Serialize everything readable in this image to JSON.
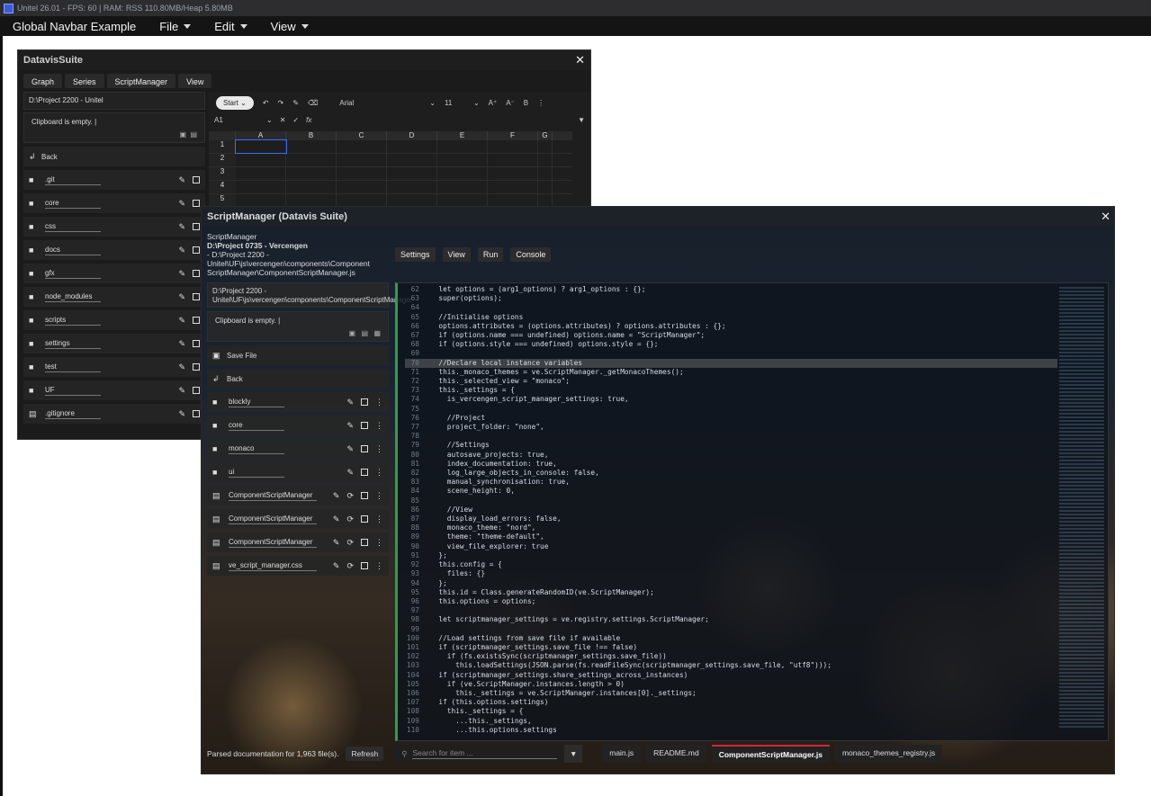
{
  "app_title": "Unitel 26.01 - FPS: 60 | RAM: RSS 110.80MB/Heap 5.80MB",
  "navbar": {
    "brand": "Global Navbar Example",
    "menus": [
      "File",
      "Edit",
      "View"
    ]
  },
  "datavis": {
    "title": "DatavisSuite",
    "tabs": [
      "Graph",
      "Series",
      "ScriptManager",
      "View"
    ],
    "path": "D:\\Project 2200 - Unitel",
    "clipboard": "Clipboard is empty.",
    "back_label": "Back",
    "items": [
      ".git",
      "core",
      "css",
      "docs",
      "gfx",
      "node_modules",
      "scripts",
      "settings",
      "test",
      "UF",
      ".gitignore"
    ],
    "sheet": {
      "start_label": "Start",
      "font": "Arial",
      "font_size": "11",
      "cell_ref": "A1",
      "fx": "fx",
      "columns": [
        "A",
        "B",
        "C",
        "D",
        "E",
        "F",
        "G"
      ],
      "rows": [
        "1",
        "2",
        "3",
        "4",
        "5"
      ]
    }
  },
  "scriptmanager": {
    "title": "ScriptManager (Datavis Suite)",
    "label": "ScriptManager",
    "project": "D:\\Project 0735 - Vercengen",
    "subpath": "- D:\\Project 2200 - Unitel\\UF\\js\\vercengen\\components\\Component ScriptManager\\ComponentScriptManager.js",
    "buttons": [
      "Settings",
      "View",
      "Run",
      "Console"
    ],
    "path": "D:\\Project 2200 - Unitel\\UF\\js\\vercengen\\components\\ComponentScriptManager",
    "clipboard": "Clipboard is empty.",
    "save_label": "Save File",
    "back_label": "Back",
    "folders": [
      "blockly",
      "core",
      "monaco",
      "ui"
    ],
    "files": [
      "ComponentScriptManager",
      "ComponentScriptManager",
      "ComponentScriptManager",
      "ve_script_manager.css"
    ],
    "code_lines": [
      {
        "n": "62",
        "t": "  let options = (arg1_options) ? arg1_options : {};"
      },
      {
        "n": "63",
        "t": "  super(options);"
      },
      {
        "n": "64",
        "t": ""
      },
      {
        "n": "65",
        "t": "  //Initialise options"
      },
      {
        "n": "66",
        "t": "  options.attributes = (options.attributes) ? options.attributes : {};"
      },
      {
        "n": "67",
        "t": "  if (options.name === undefined) options.name = \"ScriptManager\";"
      },
      {
        "n": "68",
        "t": "  if (options.style === undefined) options.style = {};"
      },
      {
        "n": "69",
        "t": ""
      },
      {
        "n": "70",
        "t": "  //Declare local instance variables"
      },
      {
        "n": "71",
        "t": "  this._monaco_themes = ve.ScriptManager._getMonacoThemes();"
      },
      {
        "n": "72",
        "t": "  this._selected_view = \"monaco\";"
      },
      {
        "n": "73",
        "t": "  this._settings = {"
      },
      {
        "n": "74",
        "t": "    is_vercengen_script_manager_settings: true,"
      },
      {
        "n": "75",
        "t": ""
      },
      {
        "n": "76",
        "t": "    //Project"
      },
      {
        "n": "77",
        "t": "    project_folder: \"none\","
      },
      {
        "n": "78",
        "t": ""
      },
      {
        "n": "79",
        "t": "    //Settings"
      },
      {
        "n": "80",
        "t": "    autosave_projects: true,"
      },
      {
        "n": "81",
        "t": "    index_documentation: true,"
      },
      {
        "n": "82",
        "t": "    log_large_objects_in_console: false,"
      },
      {
        "n": "83",
        "t": "    manual_synchronisation: true,"
      },
      {
        "n": "84",
        "t": "    scene_height: 0,"
      },
      {
        "n": "85",
        "t": ""
      },
      {
        "n": "86",
        "t": "    //View"
      },
      {
        "n": "87",
        "t": "    display_load_errors: false,"
      },
      {
        "n": "88",
        "t": "    monaco_theme: \"nord\","
      },
      {
        "n": "89",
        "t": "    theme: \"theme-default\","
      },
      {
        "n": "90",
        "t": "    view_file_explorer: true"
      },
      {
        "n": "91",
        "t": "  };"
      },
      {
        "n": "92",
        "t": "  this.config = {"
      },
      {
        "n": "93",
        "t": "    files: {}"
      },
      {
        "n": "94",
        "t": "  };"
      },
      {
        "n": "95",
        "t": "  this.id = Class.generateRandomID(ve.ScriptManager);"
      },
      {
        "n": "96",
        "t": "  this.options = options;"
      },
      {
        "n": "97",
        "t": ""
      },
      {
        "n": "98",
        "t": "  let scriptmanager_settings = ve.registry.settings.ScriptManager;"
      },
      {
        "n": "99",
        "t": ""
      },
      {
        "n": "100",
        "t": "  //Load settings from save file if available"
      },
      {
        "n": "101",
        "t": "  if (scriptmanager_settings.save_file !== false)"
      },
      {
        "n": "102",
        "t": "    if (fs.existsSync(scriptmanager_settings.save_file))"
      },
      {
        "n": "103",
        "t": "      this.loadSettings(JSON.parse(fs.readFileSync(scriptmanager_settings.save_file, \"utf8\")));"
      },
      {
        "n": "104",
        "t": "  if (scriptmanager_settings.share_settings_across_instances)"
      },
      {
        "n": "105",
        "t": "    if (ve.ScriptManager.instances.length > 0)"
      },
      {
        "n": "106",
        "t": "      this._settings = ve.ScriptManager.instances[0]._settings;"
      },
      {
        "n": "107",
        "t": "  if (this.options.settings)"
      },
      {
        "n": "108",
        "t": "    this._settings = {"
      },
      {
        "n": "109",
        "t": "      ...this._settings,"
      },
      {
        "n": "110",
        "t": "      ...this.options.settings"
      }
    ],
    "highlight_line": "70",
    "status": "Parsed documentation for 1,963 file(s).",
    "refresh_label": "Refresh",
    "search_placeholder": "Search for item ...",
    "file_tabs": [
      "main.js",
      "README.md",
      "ComponentScriptManager.js",
      "monaco_themes_registry.js"
    ],
    "active_tab": "ComponentScriptManager.js"
  }
}
